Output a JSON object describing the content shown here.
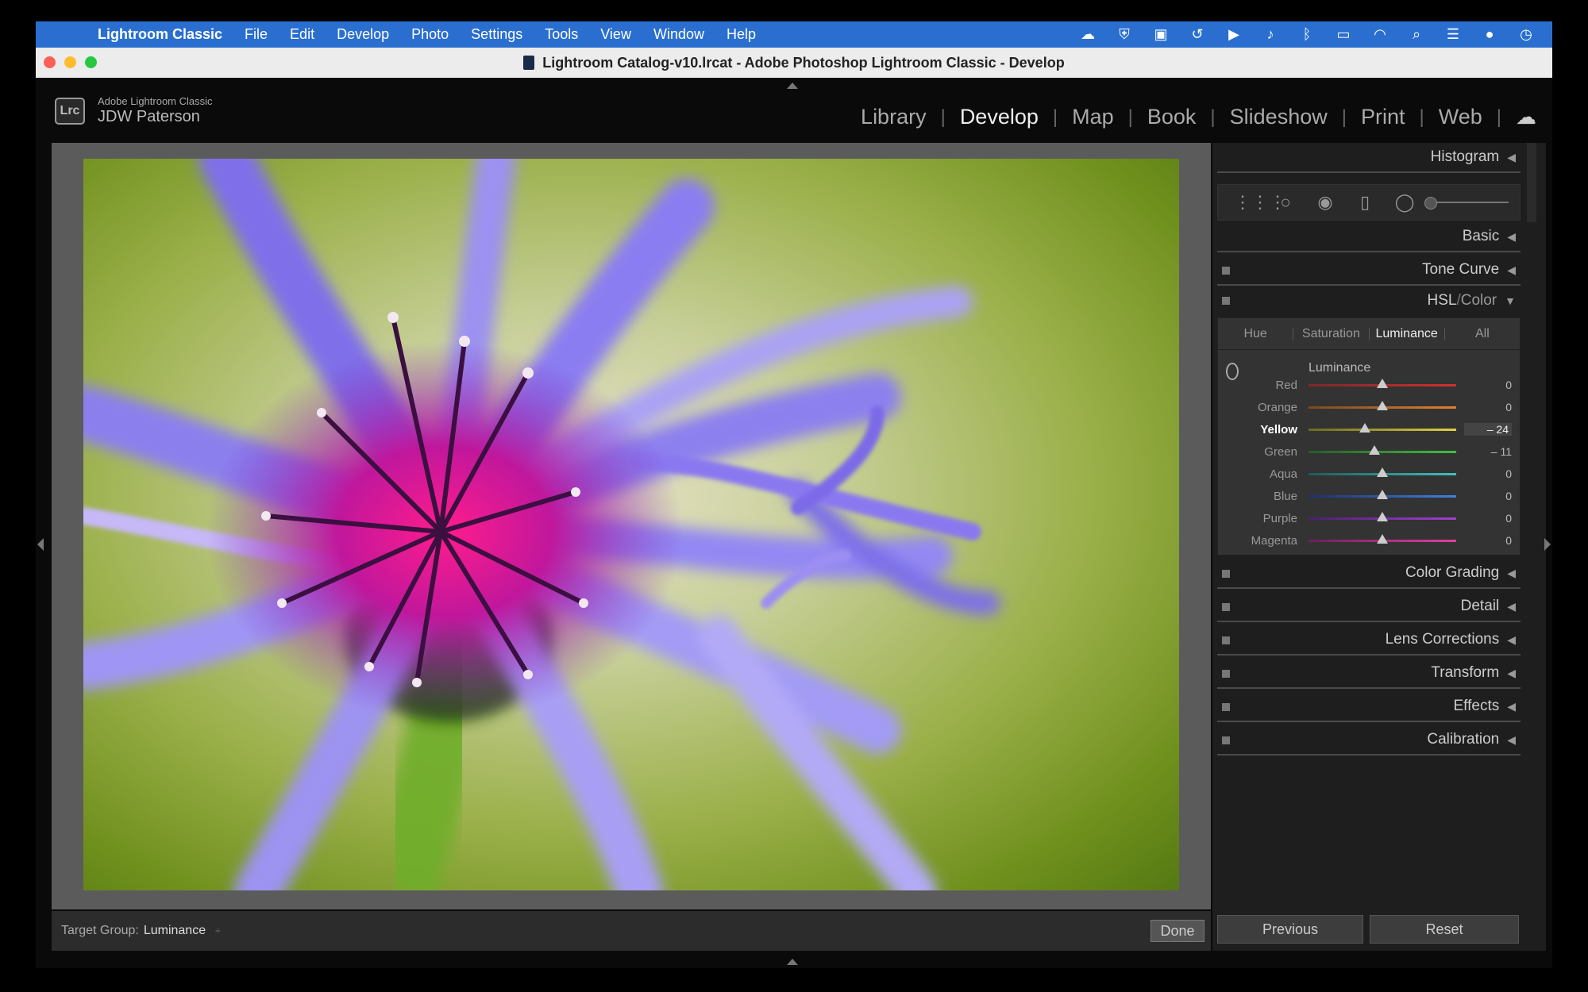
{
  "menubar": {
    "app_name": "Lightroom Classic",
    "items": [
      "File",
      "Edit",
      "Develop",
      "Photo",
      "Settings",
      "Tools",
      "View",
      "Window",
      "Help"
    ],
    "status_icons": [
      "creative-cloud-icon",
      "shield-icon",
      "display-icon",
      "time-machine-icon",
      "play-icon",
      "volume-icon",
      "bluetooth-icon",
      "battery-icon",
      "wifi-icon",
      "search-icon",
      "control-center-icon",
      "siri-icon",
      "clock-icon"
    ]
  },
  "window": {
    "title": "Lightroom Catalog-v10.lrcat - Adobe Photoshop Lightroom Classic - Develop"
  },
  "identity": {
    "logo": "Lrc",
    "product": "Adobe Lightroom Classic",
    "user": "JDW Paterson"
  },
  "modules": {
    "items": [
      "Library",
      "Develop",
      "Map",
      "Book",
      "Slideshow",
      "Print",
      "Web"
    ],
    "active": "Develop"
  },
  "toolbar": {
    "target_group_label": "Target Group:",
    "target_group_value": "Luminance",
    "caret": "÷",
    "done_label": "Done"
  },
  "panel": {
    "histogram": "Histogram",
    "basic": "Basic",
    "tone_curve": "Tone Curve",
    "hsl_label": "HSL",
    "hsl_sep": " / ",
    "color_label": "Color",
    "color_grading": "Color Grading",
    "detail": "Detail",
    "lens_corrections": "Lens Corrections",
    "transform": "Transform",
    "effects": "Effects",
    "calibration": "Calibration"
  },
  "hsl": {
    "tabs": [
      "Hue",
      "Saturation",
      "Luminance",
      "All"
    ],
    "active_tab": "Luminance",
    "section_title": "Luminance",
    "rows": [
      {
        "label": "Red",
        "value": "0",
        "level": 0,
        "from": "#7a2a2a",
        "to": "#d03030"
      },
      {
        "label": "Orange",
        "value": "0",
        "level": 0,
        "from": "#7a4a20",
        "to": "#e08030"
      },
      {
        "label": "Yellow",
        "value": "– 24",
        "level": -24,
        "from": "#6a6a20",
        "to": "#e0d040"
      },
      {
        "label": "Green",
        "value": "– 11",
        "level": -11,
        "from": "#2a5a2a",
        "to": "#40c040"
      },
      {
        "label": "Aqua",
        "value": "0",
        "level": 0,
        "from": "#205a5a",
        "to": "#40c0c0"
      },
      {
        "label": "Blue",
        "value": "0",
        "level": 0,
        "from": "#20306a",
        "to": "#4080e0"
      },
      {
        "label": "Purple",
        "value": "0",
        "level": 0,
        "from": "#4a206a",
        "to": "#a040d0"
      },
      {
        "label": "Magenta",
        "value": "0",
        "level": 0,
        "from": "#6a205a",
        "to": "#e040a0"
      }
    ]
  },
  "buttons": {
    "previous": "Previous",
    "reset": "Reset"
  }
}
